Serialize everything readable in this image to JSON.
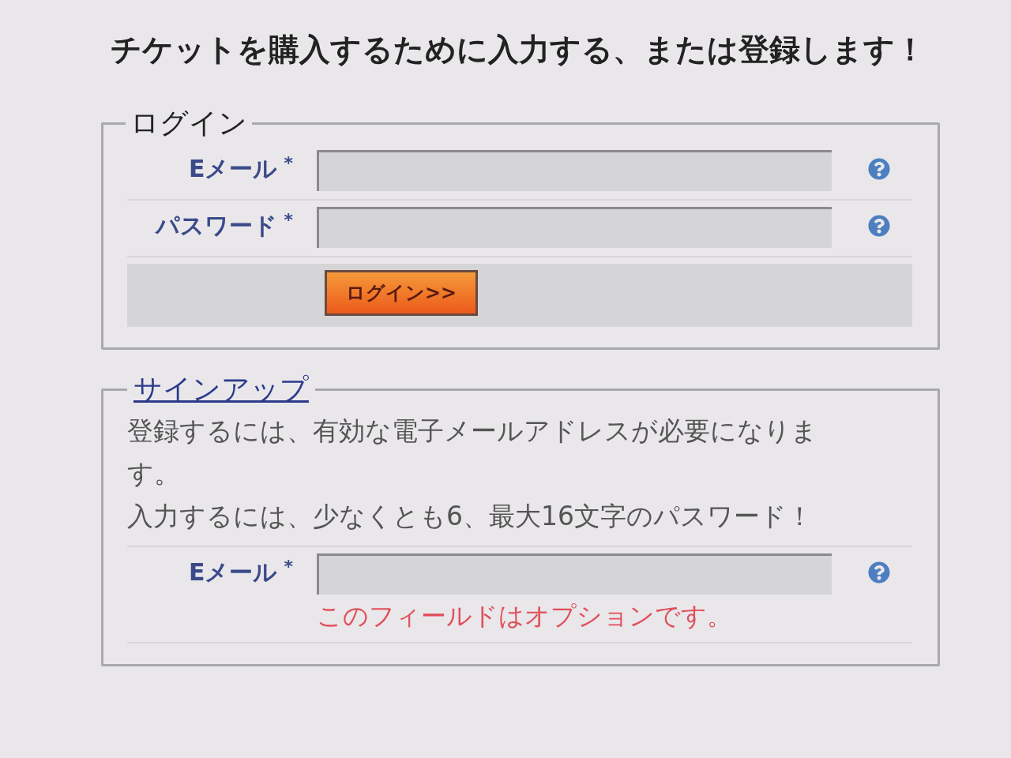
{
  "heading": "チケットを購入するために入力する、または登録します！",
  "login": {
    "legend": "ログイン",
    "fields": [
      {
        "label": "Eメール",
        "required_mark": "*"
      },
      {
        "label": "パスワード",
        "required_mark": "*"
      }
    ],
    "button": "ログイン>>"
  },
  "signup": {
    "legend": "サインアップ",
    "notes": [
      "登録するには、有効な電子メールアドレスが必要になります。",
      "入力するには、少なくとも6、最大16文字のパスワード！"
    ],
    "fields": [
      {
        "label": "Eメール",
        "required_mark": "*",
        "hint": "このフィールドはオプションです。"
      }
    ]
  }
}
